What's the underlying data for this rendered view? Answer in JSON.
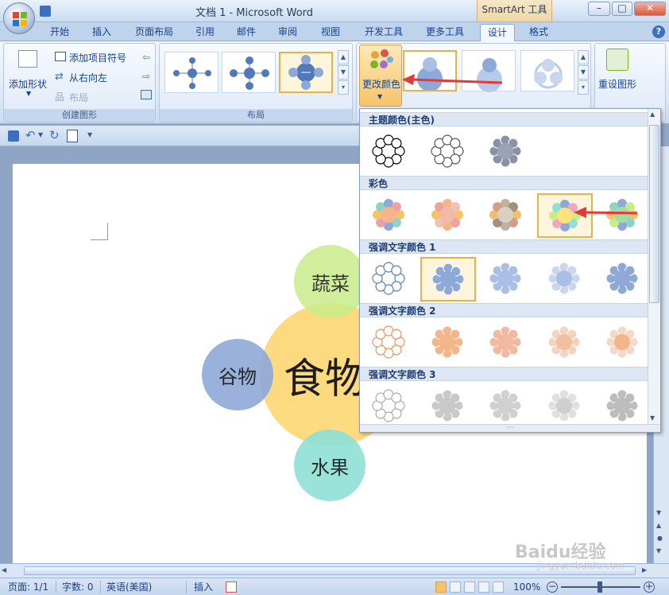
{
  "window": {
    "title": "文档 1 - Microsoft Word",
    "context_tab_group": "SmartArt 工具",
    "controls": {
      "minimize": "–",
      "restore": "□",
      "close": "✕"
    }
  },
  "ribbon_tabs": [
    {
      "label": "开始"
    },
    {
      "label": "插入"
    },
    {
      "label": "页面布局"
    },
    {
      "label": "引用"
    },
    {
      "label": "邮件"
    },
    {
      "label": "审阅"
    },
    {
      "label": "视图"
    },
    {
      "label": "开发工具"
    },
    {
      "label": "更多工具"
    },
    {
      "label": "设计",
      "active": true
    },
    {
      "label": "格式"
    }
  ],
  "help": "?",
  "ribbon": {
    "create_graphic": {
      "label": "创建图形",
      "add_shape": "添加形状",
      "add_bullet": "添加项目符号",
      "right_to_left": "从右向左",
      "layout": "布局"
    },
    "layouts": {
      "label": "布局"
    },
    "change_colors": "更改颜色",
    "reset_graphic": "重设图形"
  },
  "document": {
    "center_text": "食物",
    "top_text": "蔬菜",
    "left_text": "谷物",
    "bottom_text": "水果"
  },
  "dropdown": {
    "sections": [
      {
        "title": "主题颜色(主色)",
        "count": 3
      },
      {
        "title": "彩色",
        "count": 5,
        "selected": 3
      },
      {
        "title": "强调文字颜色 1",
        "count": 5,
        "selected": 1
      },
      {
        "title": "强调文字颜色 2",
        "count": 5
      },
      {
        "title": "强调文字颜色 3",
        "count": 5
      }
    ]
  },
  "status": {
    "page": "页面: 1/1",
    "words": "字数: 0",
    "language": "英语(美国)",
    "mode": "插入",
    "zoom": "100%"
  },
  "colors": {
    "accent_arrow": "#e53935",
    "center_circle": "#fdd97a",
    "top_circle": "#c8ec8a",
    "left_circle": "#8ea9d8",
    "bottom_circle": "#8fe0d6"
  },
  "watermark": {
    "brand": "Baidu经验",
    "url": "jingyan.baidu.com"
  }
}
